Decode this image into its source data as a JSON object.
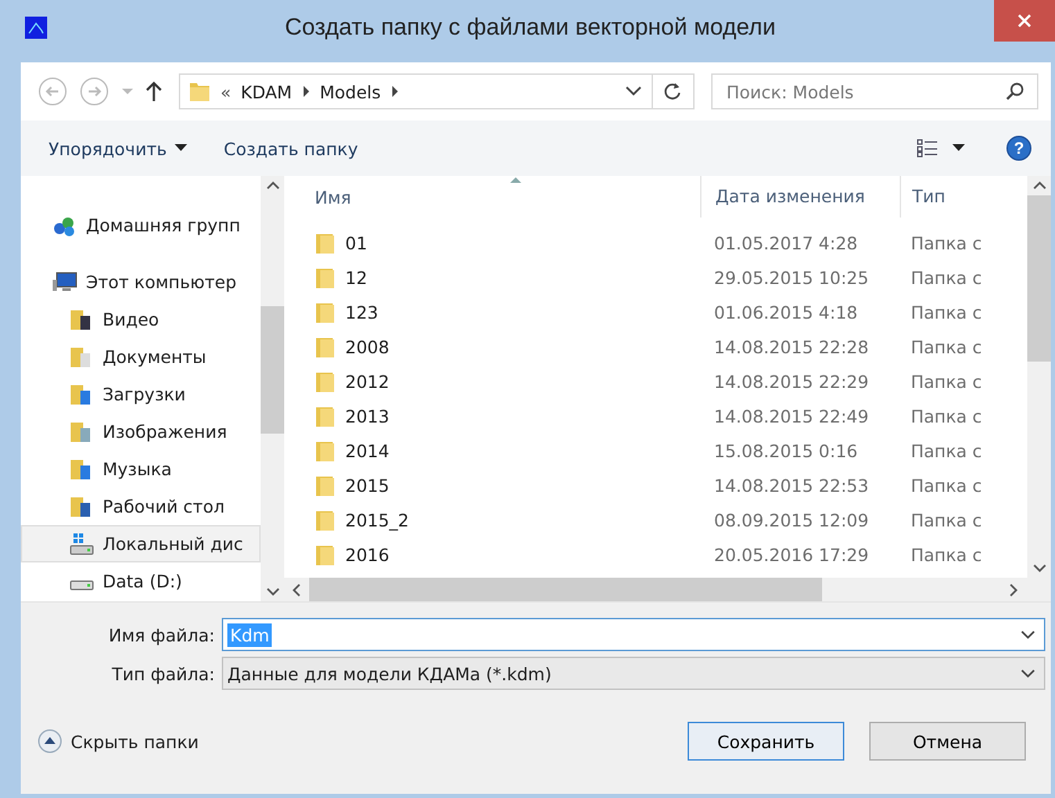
{
  "window": {
    "title": "Создать папку с файлами векторной модели"
  },
  "address_bar": {
    "overflow": "«",
    "crumbs": [
      "KDAM",
      "Models"
    ]
  },
  "search": {
    "placeholder": "Поиск: Models"
  },
  "toolbar": {
    "organize": "Упорядочить",
    "new_folder": "Создать папку",
    "help": "?"
  },
  "sidebar": {
    "items": [
      {
        "label": "Домашняя групп",
        "kind": "homegroup",
        "selected": false
      },
      {
        "label": "Этот компьютер",
        "kind": "computer",
        "selected": false,
        "children": [
          {
            "label": "Видео",
            "kind": "video",
            "selected": false
          },
          {
            "label": "Документы",
            "kind": "documents",
            "selected": false
          },
          {
            "label": "Загрузки",
            "kind": "downloads",
            "selected": false
          },
          {
            "label": "Изображения",
            "kind": "pictures",
            "selected": false
          },
          {
            "label": "Музыка",
            "kind": "music",
            "selected": false
          },
          {
            "label": "Рабочий стол",
            "kind": "desktop",
            "selected": false
          },
          {
            "label": "Локальный дис",
            "kind": "systemdrive",
            "selected": true
          },
          {
            "label": "Data (D:)",
            "kind": "drive",
            "selected": false
          }
        ]
      }
    ]
  },
  "table": {
    "columns": [
      "Имя",
      "Дата изменения",
      "Тип"
    ],
    "rows": [
      {
        "name": "01",
        "date": "01.05.2017 4:28",
        "type": "Папка с"
      },
      {
        "name": "12",
        "date": "29.05.2015 10:25",
        "type": "Папка с"
      },
      {
        "name": "123",
        "date": "01.06.2015 4:18",
        "type": "Папка с"
      },
      {
        "name": "2008",
        "date": "14.08.2015 22:28",
        "type": "Папка с"
      },
      {
        "name": "2012",
        "date": "14.08.2015 22:29",
        "type": "Папка с"
      },
      {
        "name": "2013",
        "date": "14.08.2015 22:49",
        "type": "Папка с"
      },
      {
        "name": "2014",
        "date": "15.08.2015 0:16",
        "type": "Папка с"
      },
      {
        "name": "2015",
        "date": "14.08.2015 22:53",
        "type": "Папка с"
      },
      {
        "name": "2015_2",
        "date": "08.09.2015 12:09",
        "type": "Папка с"
      },
      {
        "name": "2016",
        "date": "20.05.2016 17:29",
        "type": "Папка с"
      }
    ]
  },
  "file_name": {
    "label": "Имя файла:",
    "value": "Kdm"
  },
  "file_type": {
    "label": "Тип файла:",
    "value": "Данные для модели КДАМа (*.kdm)"
  },
  "hide_folders": "Скрыть папки",
  "buttons": [
    "Сохранить",
    "Отмена"
  ]
}
